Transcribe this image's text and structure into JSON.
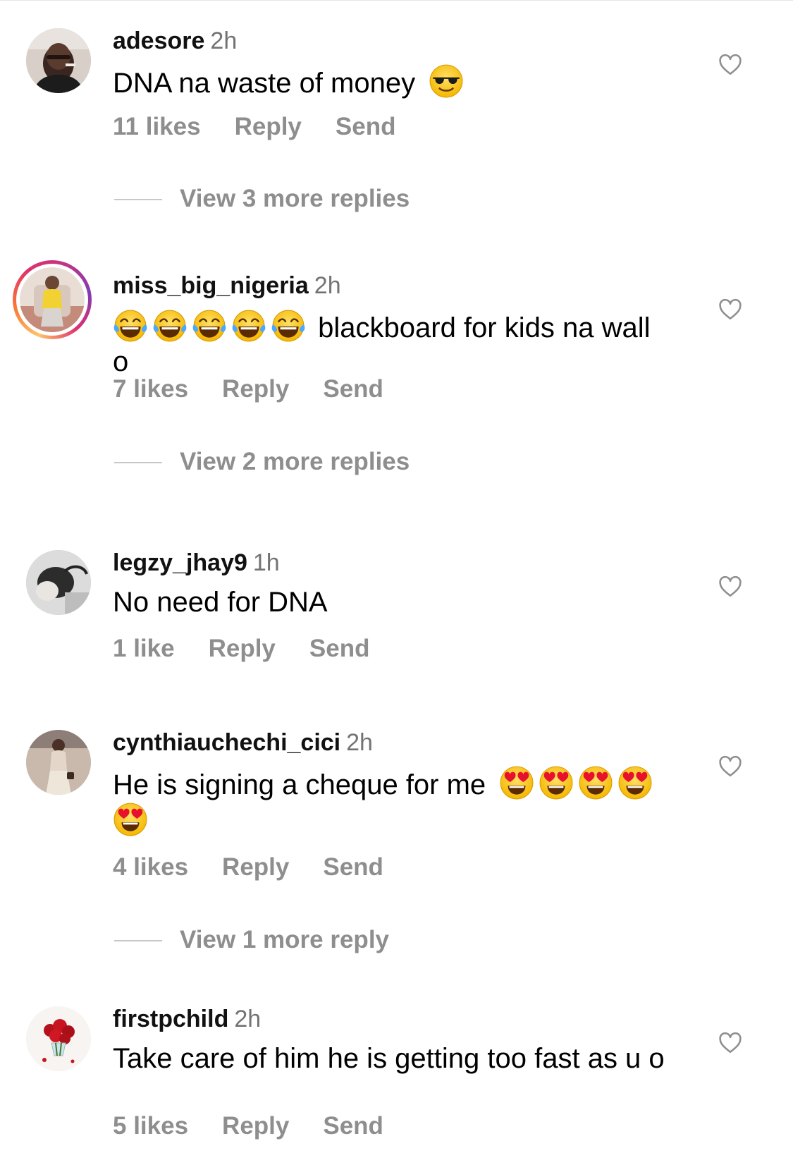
{
  "comments": [
    {
      "username": "adesore",
      "time": "2h",
      "text": "DNA na waste of money",
      "emojis_after": [
        "sunglasses-face"
      ],
      "likes": "11 likes",
      "reply": "Reply",
      "send": "Send",
      "view_more": "View 3 more replies"
    },
    {
      "username": "miss_big_nigeria",
      "time": "2h",
      "emojis_before": [
        "tears-of-joy",
        "tears-of-joy",
        "tears-of-joy",
        "tears-of-joy",
        "tears-of-joy"
      ],
      "text": "blackboard for kids na wall o",
      "likes": "7 likes",
      "reply": "Reply",
      "send": "Send",
      "view_more": "View 2 more replies"
    },
    {
      "username": "legzy_jhay9",
      "time": "1h",
      "text": "No need for DNA",
      "likes": "1 like",
      "reply": "Reply",
      "send": "Send"
    },
    {
      "username": "cynthiauchechi_cici",
      "time": "2h",
      "text": "He is signing a cheque for me",
      "emojis_after": [
        "heart-eyes",
        "heart-eyes",
        "heart-eyes",
        "heart-eyes",
        "heart-eyes"
      ],
      "likes": "4 likes",
      "reply": "Reply",
      "send": "Send",
      "view_more": "View 1 more reply"
    },
    {
      "username": "firstpchild",
      "time": "2h",
      "text": "Take care of him he is getting too fast as u o",
      "likes": "5 likes",
      "reply": "Reply",
      "send": "Send"
    }
  ],
  "colors": {
    "muted_text": "#8e8e8e",
    "time_text": "#737373",
    "story_ring": [
      "#fdc468",
      "#e1306c",
      "#833ab4"
    ]
  }
}
